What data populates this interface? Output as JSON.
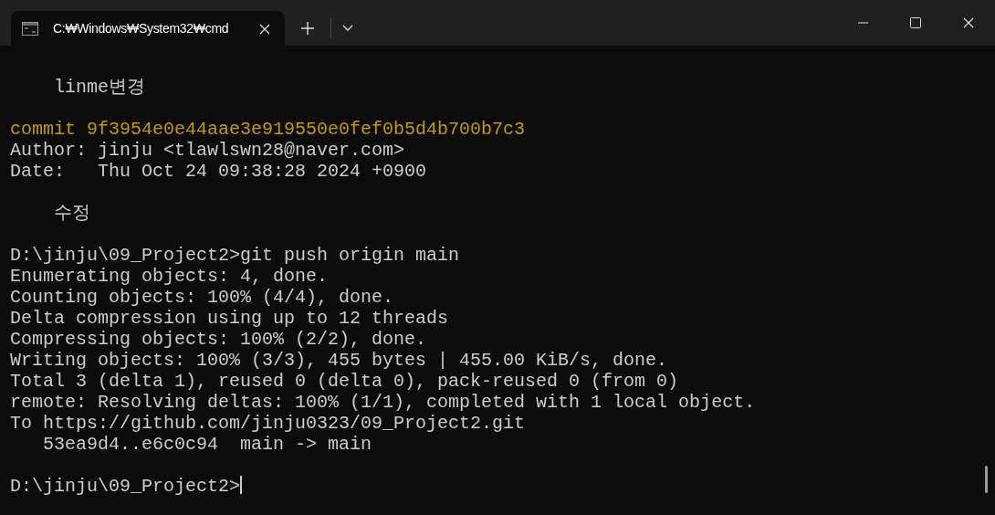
{
  "tab": {
    "title": "C:₩Windows₩System32₩cmd",
    "selected": true
  },
  "terminal": {
    "lines": [
      {
        "kind": "blank"
      },
      {
        "kind": "text",
        "text": "    linme변경"
      },
      {
        "kind": "blank"
      },
      {
        "kind": "commit",
        "text": "commit 9f3954e0e44aae3e919550e0fef0b5d4b700b7c3"
      },
      {
        "kind": "text",
        "text": "Author: jinju <tlawlswn28@naver.com>"
      },
      {
        "kind": "text",
        "text": "Date:   Thu Oct 24 09:38:28 2024 +0900"
      },
      {
        "kind": "blank"
      },
      {
        "kind": "text",
        "text": "    수정"
      },
      {
        "kind": "blank"
      },
      {
        "kind": "text",
        "text": "D:\\jinju\\09_Project2>git push origin main"
      },
      {
        "kind": "text",
        "text": "Enumerating objects: 4, done."
      },
      {
        "kind": "text",
        "text": "Counting objects: 100% (4/4), done."
      },
      {
        "kind": "text",
        "text": "Delta compression using up to 12 threads"
      },
      {
        "kind": "text",
        "text": "Compressing objects: 100% (2/2), done."
      },
      {
        "kind": "text",
        "text": "Writing objects: 100% (3/3), 455 bytes | 455.00 KiB/s, done."
      },
      {
        "kind": "text",
        "text": "Total 3 (delta 1), reused 0 (delta 0), pack-reused 0 (from 0)"
      },
      {
        "kind": "text",
        "text": "remote: Resolving deltas: 100% (1/1), completed with 1 local object."
      },
      {
        "kind": "text",
        "text": "To https://github.com/jinju0323/09_Project2.git"
      },
      {
        "kind": "text",
        "text": "   53ea9d4..e6c0c94  main -> main"
      },
      {
        "kind": "blank"
      },
      {
        "kind": "prompt",
        "text": "D:\\jinju\\09_Project2>"
      }
    ]
  }
}
